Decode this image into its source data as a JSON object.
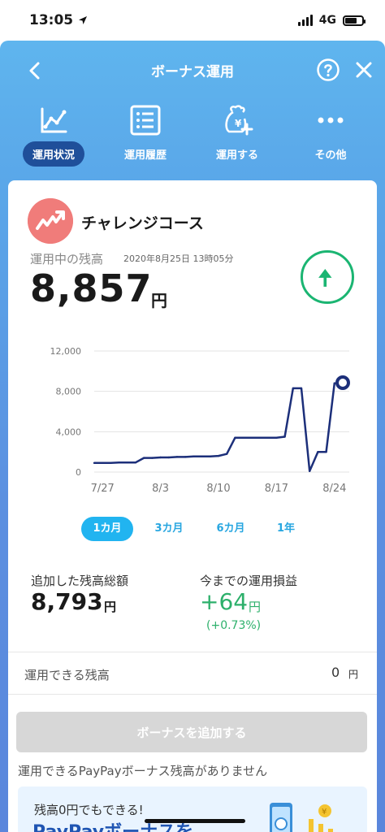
{
  "status_bar": {
    "time": "13:05",
    "network": "4G"
  },
  "nav": {
    "title": "ボーナス運用"
  },
  "tabs": [
    {
      "label": "運用状況",
      "icon": "line-chart-icon",
      "active": true
    },
    {
      "label": "運用履歴",
      "icon": "list-icon",
      "active": false
    },
    {
      "label": "運用する",
      "icon": "money-bag-plus-icon",
      "active": false
    },
    {
      "label": "その他",
      "icon": "more-icon",
      "active": false
    }
  ],
  "course": {
    "name": "チャレンジコース",
    "balance_label": "運用中の残高",
    "balance_date": "2020年8月25日 13時05分",
    "balance_amount": "8,857",
    "balance_unit": "円",
    "trend_icon": "up-arrow-icon"
  },
  "chart_data": {
    "type": "line",
    "x": [
      "7/26",
      "7/27",
      "7/28",
      "7/29",
      "7/30",
      "7/31",
      "8/1",
      "8/2",
      "8/3",
      "8/4",
      "8/5",
      "8/6",
      "8/7",
      "8/8",
      "8/9",
      "8/10",
      "8/11",
      "8/12",
      "8/13",
      "8/14",
      "8/15",
      "8/16",
      "8/17",
      "8/18",
      "8/19",
      "8/20",
      "8/21",
      "8/22",
      "8/23",
      "8/24",
      "8/25"
    ],
    "values": [
      900,
      900,
      900,
      950,
      950,
      950,
      1400,
      1400,
      1450,
      1450,
      1500,
      1500,
      1550,
      1550,
      1550,
      1600,
      1800,
      3400,
      3400,
      3400,
      3400,
      3400,
      3400,
      3500,
      8300,
      8300,
      100,
      2000,
      2000,
      8800,
      8857
    ],
    "xticks": [
      "7/27",
      "8/3",
      "8/10",
      "8/17",
      "8/24"
    ],
    "yticks": [
      "0",
      "4,000",
      "8,000",
      "12,000"
    ],
    "ylim": [
      0,
      12000
    ],
    "line_color": "#1c2f7a",
    "grid": true
  },
  "periods": [
    {
      "label": "1カ月",
      "active": true
    },
    {
      "label": "3カ月",
      "active": false
    },
    {
      "label": "6カ月",
      "active": false
    },
    {
      "label": "1年",
      "active": false
    }
  ],
  "stats": {
    "added_label": "追加した残高総額",
    "added_value": "8,793",
    "added_unit": "円",
    "profit_label": "今までの運用損益",
    "profit_value": "+64",
    "profit_unit": "円",
    "profit_pct": "(+0.73%)"
  },
  "available": {
    "label": "運用できる残高",
    "value": "0",
    "unit": "円"
  },
  "add_button": {
    "label": "ボーナスを追加する"
  },
  "no_bonus_text": "運用できるPayPayボーナス残高がありません",
  "promo": {
    "line1": "残高0円でもできる!",
    "line2": "PayPayボーナスを"
  },
  "colors": {
    "accent": "#21b4f0",
    "positive": "#2db06b",
    "active_tab": "#1f4f9a"
  }
}
